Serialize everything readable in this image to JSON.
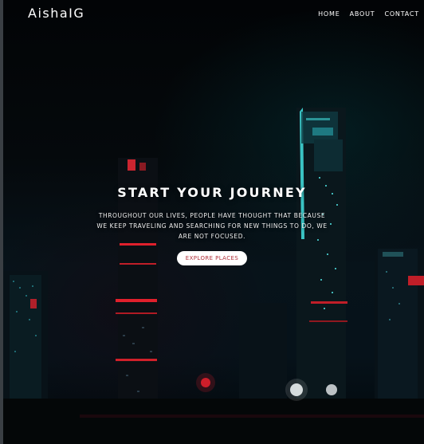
{
  "brand": {
    "logo_text": "AishaIG"
  },
  "nav": {
    "items": [
      {
        "label": "HOME"
      },
      {
        "label": "ABOUT"
      },
      {
        "label": "CONTACT"
      }
    ]
  },
  "hero": {
    "title": "START YOUR JOURNEY",
    "subtitle": "THROUGHOUT OUR LIVES, PEOPLE HAVE THOUGHT THAT BECAUSE WE KEEP TRAVELING AND SEARCHING FOR NEW THINGS TO DO, WE ARE NOT FOCUSED.",
    "cta_label": "EXPLORE PLACES"
  },
  "colors": {
    "accent": "#b0303a",
    "neon_teal": "#3fd6d6",
    "neon_red": "#e0202c",
    "background": "#05090c"
  },
  "background_image": "night-city-skyline"
}
